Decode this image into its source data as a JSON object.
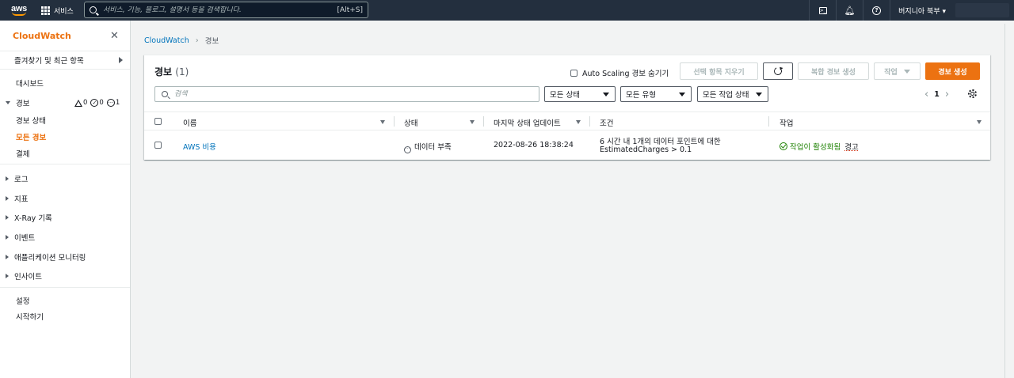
{
  "topnav": {
    "logo_text": "aws",
    "services_label": "서비스",
    "search_placeholder": "서비스, 기능, 블로그, 설명서 등을 검색합니다.",
    "search_shortcut": "[Alt+S]",
    "region": "버지니아 북부 ▾"
  },
  "sidebar": {
    "title": "CloudWatch",
    "favorites": "즐겨찾기 및 최근 항목",
    "dashboard": "대시보드",
    "alarms_group": "경보",
    "alarm_counts": {
      "alarm": "0",
      "ok": "0",
      "insufficient": "1"
    },
    "alarm_state": "경보 상태",
    "all_alarms": "모든 경보",
    "billing": "결제",
    "logs": "로그",
    "metrics": "지표",
    "xray": "X-Ray 기록",
    "events": "이벤트",
    "app_monitoring": "애플리케이션 모니터링",
    "insights": "인사이트",
    "settings": "설정",
    "getting_started": "시작하기"
  },
  "breadcrumb": {
    "root": "CloudWatch",
    "current": "경보"
  },
  "panel": {
    "title": "경보",
    "count": "(1)",
    "autoscaling_label": "Auto Scaling 경보 숨기기",
    "clear_selection": "선택 항목 지우기",
    "composite": "복합 경보 생성",
    "actions": "작업",
    "create": "경보 생성",
    "filter_placeholder": "검색",
    "state_select": "모든 상태",
    "type_select": "모든 유형",
    "action_state_select": "모든 작업 상태",
    "page": "1"
  },
  "table": {
    "columns": [
      "이름",
      "상태",
      "마지막 상태 업데이트",
      "조건",
      "작업"
    ],
    "rows": [
      {
        "name": "AWS 비용",
        "state": "데이터 부족",
        "updated": "2022-08-26 18:38:24",
        "condition_1": "6 시간 내 1개의 데이터 포인트에 대한",
        "condition_2": "EstimatedCharges > 0.1",
        "actions_status": "작업이 활성화됨",
        "actions_link": "경고"
      }
    ]
  },
  "colors": {
    "accent": "#ec7211",
    "link": "#0073bb",
    "ok": "#1d8102",
    "nav": "#232f3e"
  }
}
